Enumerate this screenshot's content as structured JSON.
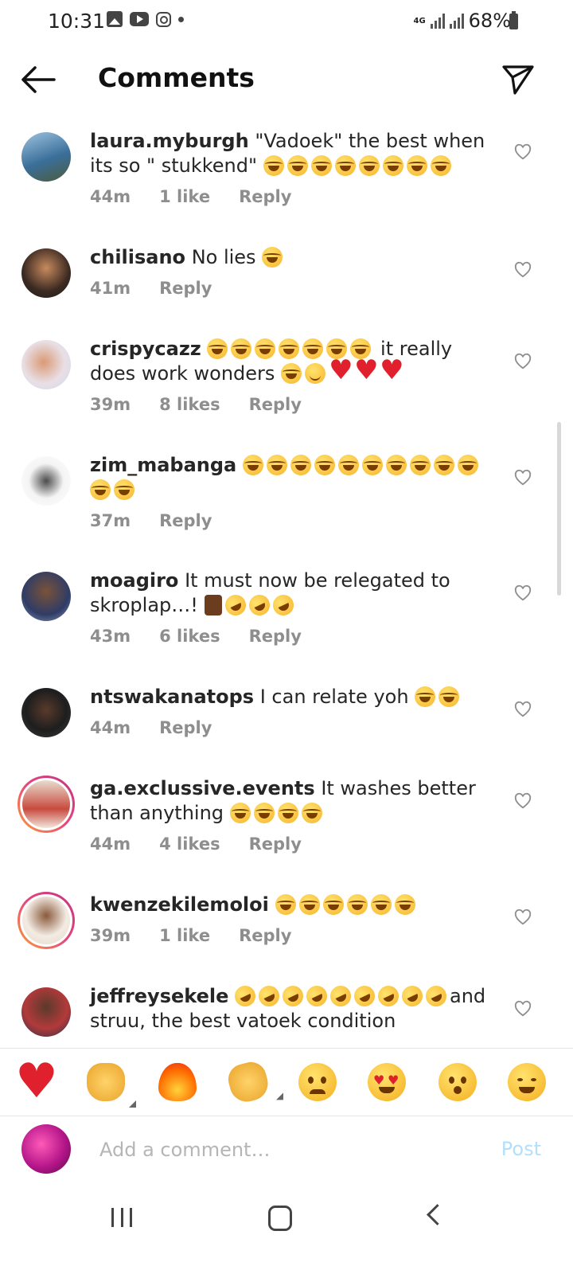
{
  "status_bar": {
    "time": "10:31",
    "network": "4G",
    "battery": "68%"
  },
  "header": {
    "title": "Comments"
  },
  "comments": [
    {
      "username": "laura.myburgh",
      "text": "\"Vadoek\" the best when its so \" stukkend\"",
      "time": "44m",
      "likes": "1 like",
      "reply": "Reply"
    },
    {
      "username": "chilisano",
      "text": "No lies",
      "time": "41m",
      "likes": "",
      "reply": "Reply"
    },
    {
      "username": "crispycazz",
      "text": "it really does work wonders",
      "time": "39m",
      "likes": "8 likes",
      "reply": "Reply"
    },
    {
      "username": "zim_mabanga",
      "text": "",
      "time": "37m",
      "likes": "",
      "reply": "Reply"
    },
    {
      "username": "moagiro",
      "text": "It must now be relegated to skroplap…!",
      "time": "43m",
      "likes": "6 likes",
      "reply": "Reply"
    },
    {
      "username": "ntswakanatops",
      "text": "I can relate yoh",
      "time": "44m",
      "likes": "",
      "reply": "Reply"
    },
    {
      "username": "ga.exclussive.events",
      "text": "It washes better than anything",
      "time": "44m",
      "likes": "4 likes",
      "reply": "Reply"
    },
    {
      "username": "kwenzekilemoloi",
      "text": "",
      "time": "39m",
      "likes": "1 like",
      "reply": "Reply"
    },
    {
      "username": "jeffreysekele",
      "text": "and struu, the best vatoek condition",
      "time": "",
      "likes": "",
      "reply": ""
    }
  ],
  "reactions": [
    "red-heart",
    "raising-hands",
    "fire",
    "clapping-hands",
    "crying-face",
    "heart-eyes-face",
    "surprised-face",
    "tears-of-joy-face"
  ],
  "composer": {
    "placeholder": "Add a comment…",
    "post_label": "Post"
  },
  "colors": {
    "post_disabled": "#b2dffc",
    "heart": "#e0202c",
    "meta": "#8e8e8e"
  }
}
